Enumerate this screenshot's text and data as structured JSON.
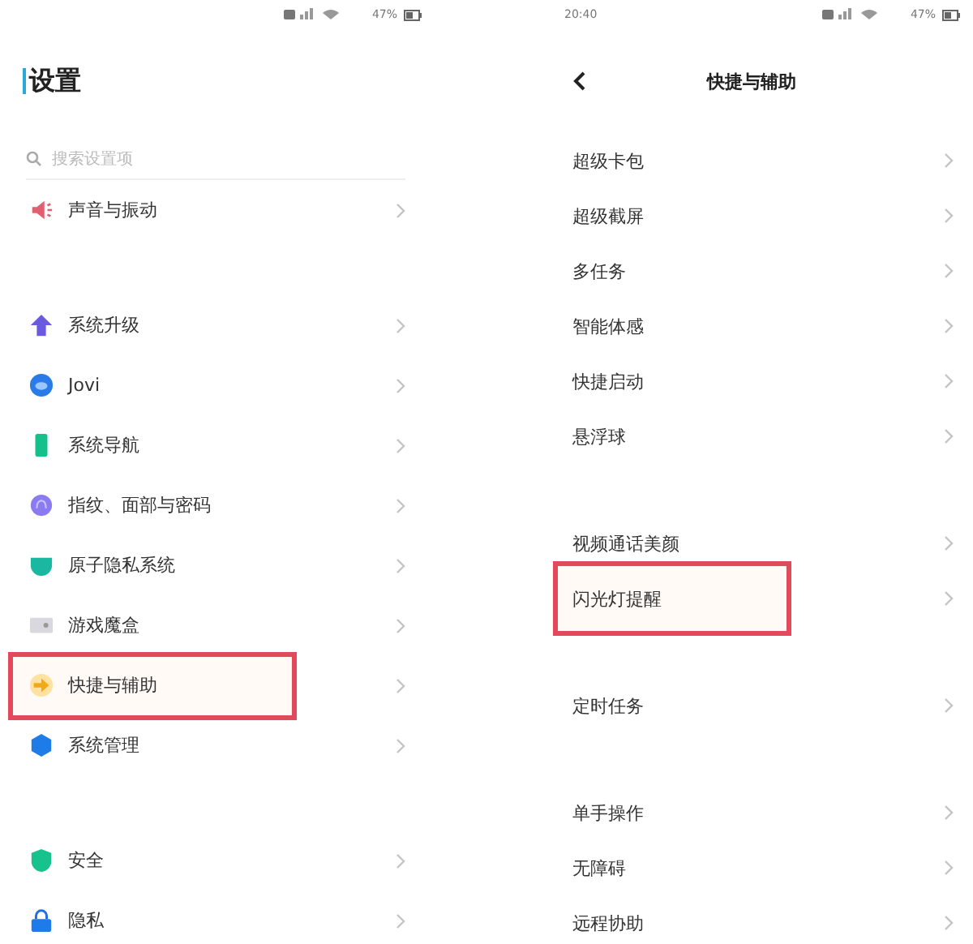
{
  "left_screen": {
    "status_bar": {
      "battery": "47%"
    },
    "title": "设置",
    "search": {
      "placeholder": "搜索设置项"
    },
    "groups": [
      [
        {
          "label": "声音与振动",
          "kind": "speaker",
          "highlighted": false
        }
      ],
      [
        {
          "label": "系统升级",
          "kind": "arrow-up",
          "highlighted": false
        },
        {
          "label": "Jovi",
          "kind": "bubble",
          "highlighted": false
        },
        {
          "label": "系统导航",
          "kind": "phone",
          "highlighted": false
        },
        {
          "label": "指纹、面部与密码",
          "kind": "fingerprint",
          "highlighted": false
        },
        {
          "label": "原子隐私系统",
          "kind": "cup",
          "highlighted": false
        },
        {
          "label": "游戏魔盒",
          "kind": "gamebox",
          "highlighted": false
        },
        {
          "label": "快捷与辅助",
          "kind": "arrow-right",
          "highlighted": true
        },
        {
          "label": "系统管理",
          "kind": "hexagon",
          "highlighted": false
        }
      ],
      [
        {
          "label": "安全",
          "kind": "shield",
          "highlighted": false
        },
        {
          "label": "隐私",
          "kind": "lock",
          "highlighted": false
        }
      ]
    ]
  },
  "right_screen": {
    "status_bar": {
      "time": "20:40",
      "battery": "47%"
    },
    "title": "快捷与辅助",
    "groups": [
      [
        {
          "label": "超级卡包",
          "highlighted": false
        },
        {
          "label": "超级截屏",
          "highlighted": false
        },
        {
          "label": "多任务",
          "highlighted": false
        },
        {
          "label": "智能体感",
          "highlighted": false
        },
        {
          "label": "快捷启动",
          "highlighted": false
        },
        {
          "label": "悬浮球",
          "highlighted": false
        }
      ],
      [
        {
          "label": "视频通话美颜",
          "highlighted": false
        },
        {
          "label": "闪光灯提醒",
          "highlighted": true
        }
      ],
      [
        {
          "label": "定时任务",
          "highlighted": false
        }
      ],
      [
        {
          "label": "单手操作",
          "highlighted": false
        },
        {
          "label": "无障碍",
          "highlighted": false
        },
        {
          "label": "远程协助",
          "highlighted": false
        }
      ]
    ]
  }
}
